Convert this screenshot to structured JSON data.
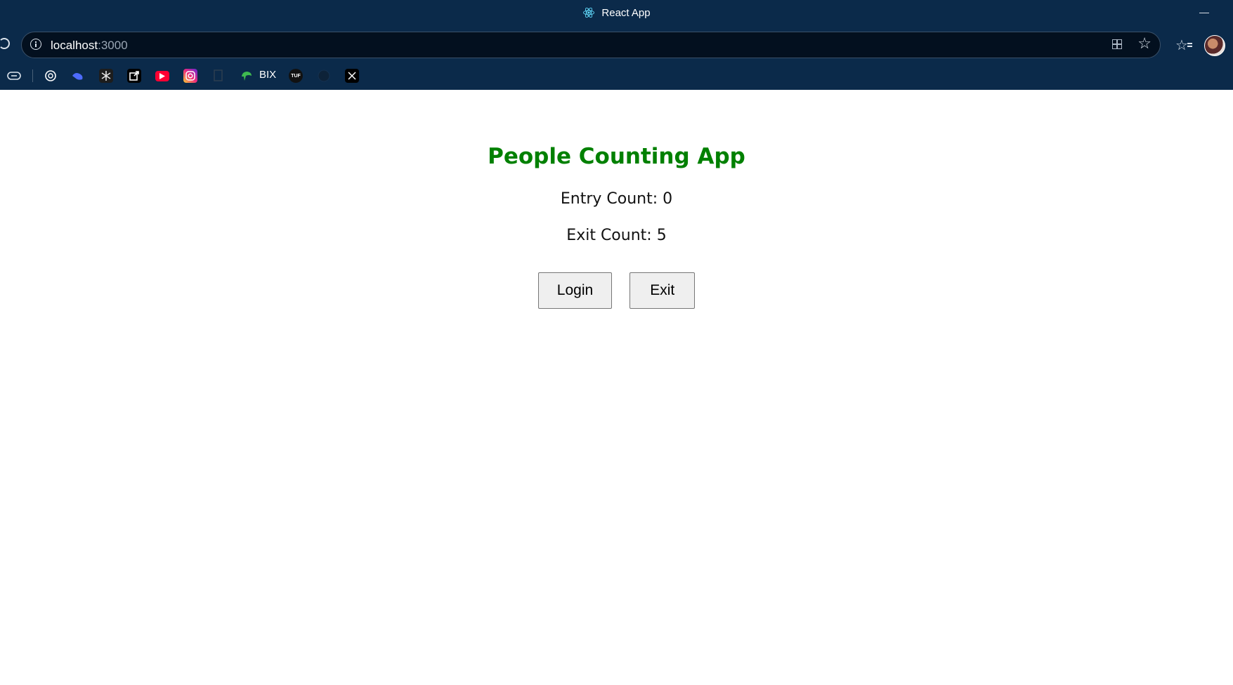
{
  "window": {
    "title": "React App",
    "favicon": "react-icon"
  },
  "addressbar": {
    "host": "localhost",
    "port": ":3000"
  },
  "bookmarks": [
    {
      "name": "tab-actions-icon",
      "color": "#dbe3ec"
    },
    {
      "name": "chatgpt-icon",
      "color": "#ffffff"
    },
    {
      "name": "deepseek-icon",
      "color": "#4d6bfe"
    },
    {
      "name": "perplexity-icon",
      "color": "#20808d"
    },
    {
      "name": "external-link-icon",
      "color": "#000000"
    },
    {
      "name": "youtube-icon",
      "color": "#ff0033"
    },
    {
      "name": "instagram-icon",
      "color": "#dd2a7b"
    },
    {
      "name": "generic-page-icon",
      "color": "#2c3e50"
    },
    {
      "name": "bix-icon",
      "color": "#3fb950",
      "label": "BIX"
    },
    {
      "name": "tuf-icon",
      "color": "#111111",
      "label": "TUF"
    },
    {
      "name": "github-icon",
      "color": "#0d2238"
    },
    {
      "name": "x-icon",
      "color": "#000000"
    }
  ],
  "app": {
    "title": "People Counting App",
    "entry_label": "Entry Count:",
    "entry_count": 0,
    "entry_text": "Entry Count: 0",
    "exit_label": "Exit Count:",
    "exit_count": 5,
    "exit_text": "Exit Count: 5",
    "login_button": "Login",
    "exit_button": "Exit",
    "title_color": "#008000"
  }
}
